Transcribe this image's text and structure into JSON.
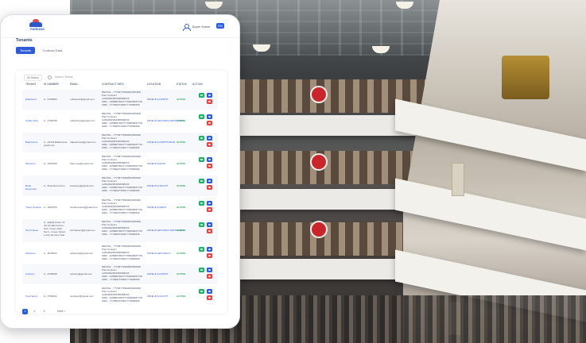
{
  "app": {
    "logo_text": "PARKING",
    "user_name": "Buyer Name",
    "lang_label": "EN",
    "page_title": "Tenants",
    "tabs": [
      {
        "label": "Tenants",
        "active": true
      },
      {
        "label": "Contract Data",
        "active": false
      }
    ]
  },
  "filters": {
    "select_label": "All Status",
    "search_placeholder": "Search Tenant"
  },
  "table": {
    "columns": [
      "TENANT",
      "ID NUMBER",
      "EMAIL",
      "CONTRACT INFO",
      "LOCATION",
      "STATUS",
      "ACTION"
    ],
    "rows": [
      {
        "tenant": "Edelweiss",
        "id": "A - 2345983",
        "email": "edelweiss@gmail.com",
        "contract": [
          "RENTAL - 77768779982993456000",
          "Pilot Contract",
          "12394832909458398233",
          "0000 - 345888798477798299837739",
          "0000 - 7779982739847774688338"
        ],
        "location": "ZONE-B-3-NORTH",
        "status": "ACTIVE"
      },
      {
        "tenant": "Coffee Hive",
        "id": "A - 2789765",
        "email": "coffeehive@gmail.com",
        "contract": [
          "RENTAL - 77768779982993456000",
          "Pilot Contract",
          "12394832909458398233",
          "0000 - 345888798477798299837739",
          "0000 - 7779982739847774688338"
        ],
        "location": "ZONE-B-GROUND-NORTH-MAIN",
        "status": "ACTIVE"
      },
      {
        "tenant": "Bakehouse",
        "id": "A - 23478 Bakehouse gmail.com",
        "email": "bakehouse@gmail.com",
        "contract": [
          "RENTAL - 77768779982993456000",
          "Pilot Contract",
          "12394832909458398233",
          "0000 - 345888798477798299837739",
          "0000 - 7779982739847774688338"
        ],
        "location": "ZONE-B-3-NORTH-MAIN",
        "status": "ACTIVE"
      },
      {
        "tenant": "Harmony",
        "id": "A - 2456789",
        "email": "harmony@gmail.com",
        "contract": [
          "RENTAL - 77768779982993456000",
          "Pilot Contract",
          "12394832909458398233",
          "0000 - 345888798477798299837739",
          "0000 - 7779982739847774688338"
        ],
        "location": "ZONE-B-3-EAST",
        "status": "ACTIVE"
      },
      {
        "tenant": "Book Emporium",
        "id": "A - Book Emporium",
        "email": "bookemp@gmail.com",
        "contract": [
          "RENTAL - 77768779982993456000",
          "Pilot Contract",
          "12394832909458398233",
          "0000 - 345888798477798299837739",
          "0000 - 7779982739847774688338"
        ],
        "location": "ZONE-B-3-SOUTH",
        "status": "ACTIVE"
      },
      {
        "tenant": "Trend Couture",
        "id": "A - 2987654",
        "email": "trendcouture@gmail.com",
        "contract": [
          "RENTAL - 77768779982993456000",
          "Pilot Contract",
          "12394832909458398233",
          "0000 - 345888798477798299837739",
          "0000 - 7779982739847774688338"
        ],
        "location": "ZONE-B-3-WEST",
        "status": "ACTIVE"
      },
      {
        "tenant": "Tech Haven",
        "id": "A - Digital Tower Of the Art Electronics - Hub, Green Rain Tech - Green Street, Lucky Number Flat",
        "email": "techhaven@gmail.com",
        "contract": [
          "RENTAL - 77768779982993456000",
          "Pilot Contract",
          "12394832909458398233",
          "0000 - 345888798477798299837739",
          "0000 - 7779982739847774688338"
        ],
        "location": "ZONE-B-GROUND-NORTH-MAIN",
        "status": "ACTIVE"
      },
      {
        "tenant": "Wellness",
        "id": "A - 2876543",
        "email": "wellness@gmail.com",
        "contract": [
          "RENTAL - 77768779982993456000",
          "Pilot Contract",
          "12394832909458398233",
          "0000 - 345888798477798299837739",
          "0000 - 7779982739847774688338"
        ],
        "location": "ZONE-B-GROUND-C",
        "status": "ACTIVE"
      },
      {
        "tenant": "Culinary",
        "id": "A - 2345098",
        "email": "culinary@gmail.com",
        "contract": [
          "RENTAL - 77768779982993456000",
          "Pilot Contract",
          "12394832909458398233",
          "0000 - 345888798477798299837739",
          "0000 - 7779982739847774688338"
        ],
        "location": "ZONE-B-3-NORTH",
        "status": "ACTIVE"
      },
      {
        "tenant": "Cool Sport",
        "id": "A - 2765432",
        "email": "coolsport@gmail.com",
        "contract": [
          "RENTAL - 77768779982993456000",
          "Pilot Contract",
          "12394832909458398233",
          "0000 - 345888798477798299837739",
          "0000 - 7779982739847774688338"
        ],
        "location": "ZONE-B-3-SOUTH",
        "status": "ACTIVE"
      }
    ]
  },
  "pagination": {
    "pages": [
      "1",
      "2",
      "3"
    ],
    "active": "1",
    "next_label": "Next >"
  },
  "colors": {
    "primary": "#2f5cd9",
    "status_active": "#24a35b",
    "action_view": "#23b067",
    "action_edit": "#2f5cd9",
    "action_delete": "#e04848"
  }
}
